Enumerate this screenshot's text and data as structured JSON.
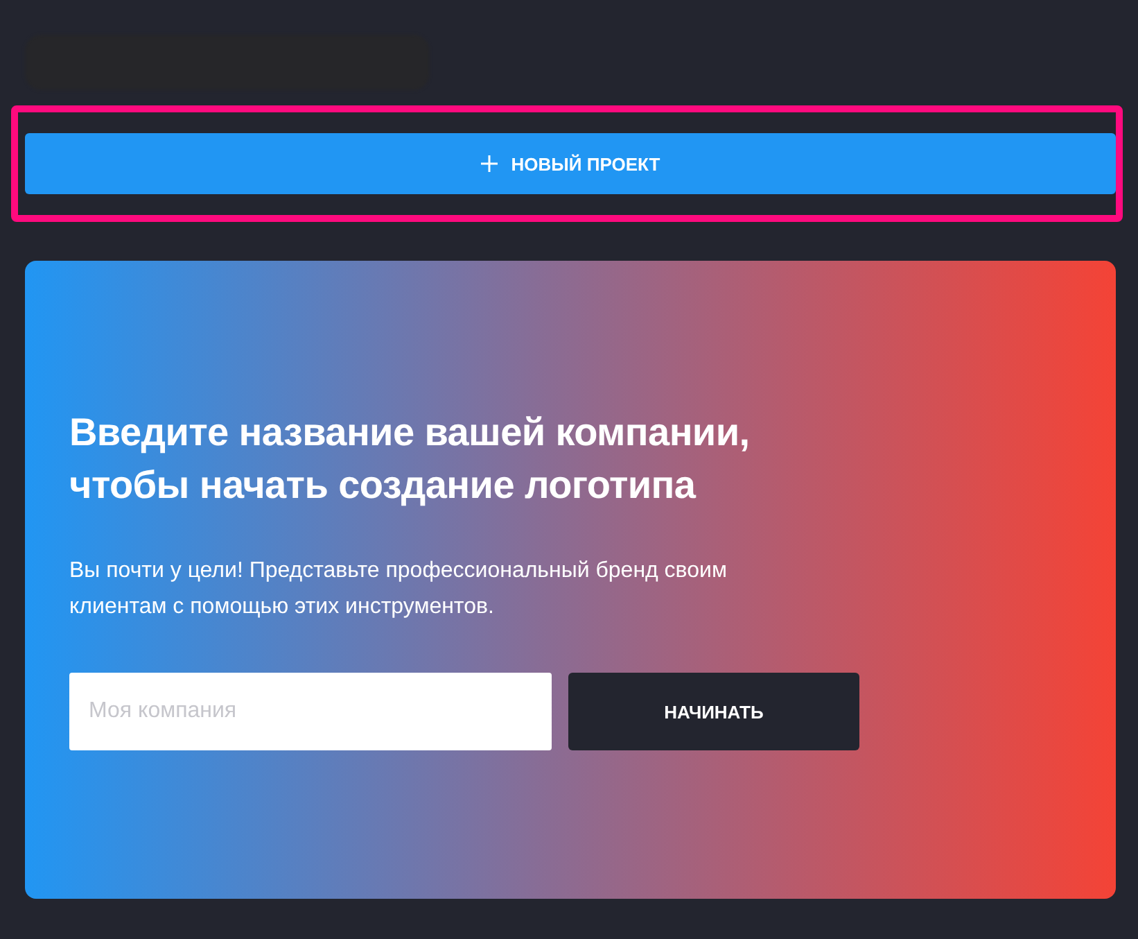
{
  "header": {
    "redacted": true
  },
  "new_project_button": {
    "label": "НОВЫЙ ПРОЕКТ",
    "highlighted": true
  },
  "promo": {
    "heading": "Введите название вашей компании,\nчтобы начать создание логотипа",
    "text": "Вы почти у цели! Представьте профессиональный бренд своим клиентам с помощью этих инструментов.",
    "company_field": {
      "placeholder": "Моя компания"
    },
    "start_button": "НАЧИНАТЬ"
  }
}
